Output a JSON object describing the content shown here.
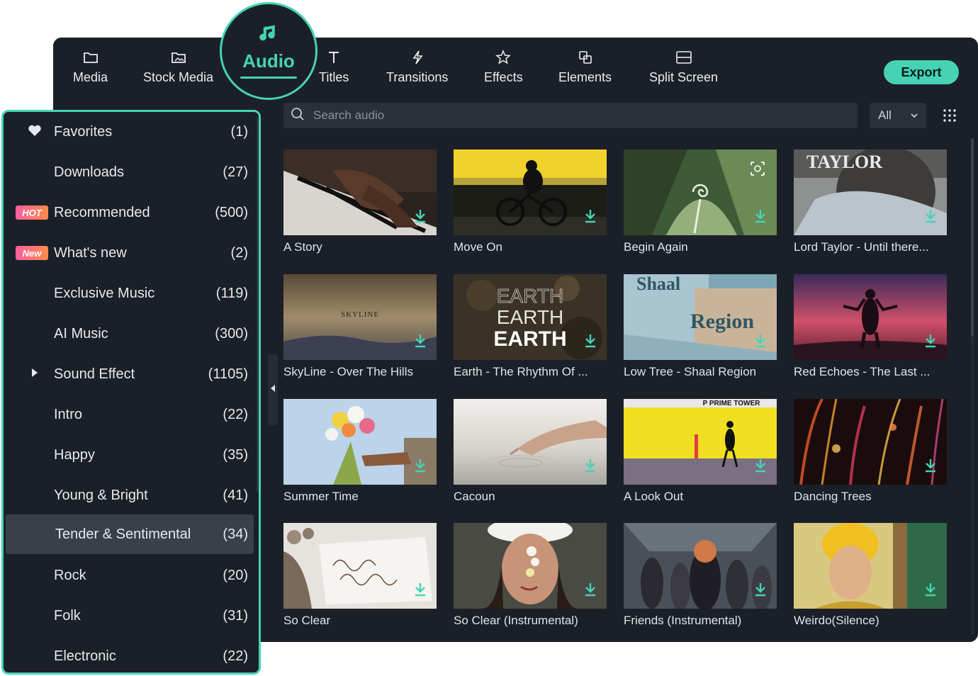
{
  "tabs": [
    {
      "label": "Media",
      "icon": "folder-icon"
    },
    {
      "label": "Stock Media",
      "icon": "stock-media-icon"
    },
    {
      "label": "Audio",
      "icon": "music-note-icon"
    },
    {
      "label": "Titles",
      "icon": "text-t-icon"
    },
    {
      "label": "Transitions",
      "icon": "transitions-icon"
    },
    {
      "label": "Effects",
      "icon": "effects-star-icon"
    },
    {
      "label": "Elements",
      "icon": "elements-icon"
    },
    {
      "label": "Split Screen",
      "icon": "split-screen-icon"
    }
  ],
  "export_label": "Export",
  "search": {
    "placeholder": "Search audio"
  },
  "filter": {
    "value": "All"
  },
  "colors": {
    "accent": "#45d3b4",
    "background": "#1b2028",
    "active_row": "#3a4049"
  },
  "sidebar": {
    "items": [
      {
        "label": "Favorites",
        "count": "(1)",
        "icon": "heart-icon"
      },
      {
        "label": "Downloads",
        "count": "(27)"
      },
      {
        "label": "Recommended",
        "count": "(500)",
        "badge": "HOT"
      },
      {
        "label": "What's new",
        "count": "(2)",
        "badge": "New"
      },
      {
        "label": "Exclusive Music",
        "count": "(119)"
      },
      {
        "label": "AI Music",
        "count": "(300)"
      },
      {
        "label": "Sound Effect",
        "count": "(1105)",
        "icon": "expand-arrow-icon"
      },
      {
        "label": "Intro",
        "count": "(22)"
      },
      {
        "label": "Happy",
        "count": "(35)"
      },
      {
        "label": "Young & Bright",
        "count": "(41)"
      },
      {
        "label": "Tender & Sentimental",
        "count": "(34)",
        "active": true
      },
      {
        "label": "Rock",
        "count": "(20)"
      },
      {
        "label": "Folk",
        "count": "(31)"
      },
      {
        "label": "Electronic",
        "count": "(22)"
      }
    ]
  },
  "tracks": [
    {
      "title": "A Story"
    },
    {
      "title": "Move On"
    },
    {
      "title": "Begin Again"
    },
    {
      "title": "Lord Taylor - Until there..."
    },
    {
      "title": "SkyLine - Over The Hills"
    },
    {
      "title": "Earth - The Rhythm Of ..."
    },
    {
      "title": "Low Tree - Shaal Region"
    },
    {
      "title": "Red Echoes - The Last ..."
    },
    {
      "title": "Summer Time"
    },
    {
      "title": "Cacoun"
    },
    {
      "title": "A Look Out"
    },
    {
      "title": "Dancing Trees"
    },
    {
      "title": "So Clear"
    },
    {
      "title": "So Clear (Instrumental)"
    },
    {
      "title": "Friends (Instrumental)"
    },
    {
      "title": "Weirdo(Silence)"
    }
  ],
  "thumb_text": {
    "lord_taylor": "TAYLOR",
    "skyline": "SKYLINE",
    "earth_1": "EARTH",
    "earth_2": "EARTH",
    "earth_3": "EARTH",
    "shaal": "Shaal",
    "region": "Region",
    "tower": "P PRIME TOWER"
  }
}
